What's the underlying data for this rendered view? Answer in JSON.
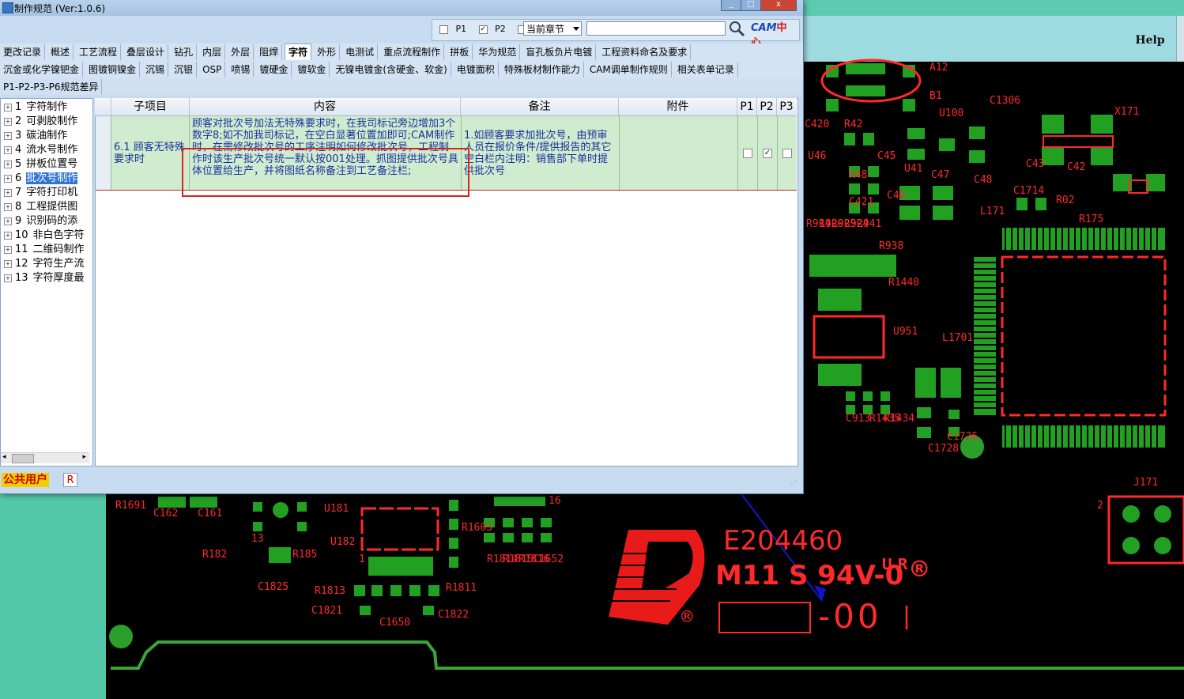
{
  "window": {
    "title": "制作规范 (Ver:1.0.6)",
    "min_label": "_",
    "max_label": "□",
    "close_label": "x"
  },
  "toolbar": {
    "p1_label": "P1",
    "p2_label": "P2",
    "p3_label": "P3",
    "p1_checked": false,
    "p2_checked": true,
    "p3_checked": false,
    "chapter_select": "当前章节",
    "search_value": "",
    "logo_text": "CAM",
    "logo_suffix": "中心"
  },
  "tabs_row1": [
    "更改记录",
    "概述",
    "工艺流程",
    "叠层设计",
    "钻孔",
    "内层",
    "外层",
    "阻焊",
    "字符",
    "外形",
    "电测试",
    "重点流程制作",
    "拼板",
    "华为规范",
    "盲孔板负片电镀",
    "工程资料命名及要求"
  ],
  "active_tab": "字符",
  "tabs_row2": [
    "沉金或化学镍钯金",
    "图镀铜镍金",
    "沉锡",
    "沉银",
    "OSP",
    "喷锡",
    "镀硬金",
    "镀软金",
    "无镍电镀金(含硬金、软金)",
    "电镀面积",
    "特殊板材制作能力",
    "CAM调单制作规则",
    "相关表单记录"
  ],
  "tabs_row3": [
    "P1-P2-P3-P6规范差异"
  ],
  "tree": [
    {
      "num": "1",
      "label": "字符制作"
    },
    {
      "num": "2",
      "label": "可剥胶制作"
    },
    {
      "num": "3",
      "label": "碳油制作"
    },
    {
      "num": "4",
      "label": "流水号制作"
    },
    {
      "num": "5",
      "label": "拼板位置号"
    },
    {
      "num": "6",
      "label": "批次号制作"
    },
    {
      "num": "7",
      "label": "字符打印机"
    },
    {
      "num": "8",
      "label": "工程提供图"
    },
    {
      "num": "9",
      "label": "识别码的添"
    },
    {
      "num": "10",
      "label": "非白色字符"
    },
    {
      "num": "11",
      "label": "二维码制作"
    },
    {
      "num": "12",
      "label": "字符生产流"
    },
    {
      "num": "13",
      "label": "字符厚度最"
    }
  ],
  "selected_tree_index": 5,
  "grid": {
    "headers": [
      "子项目",
      "内容",
      "备注",
      "附件",
      "P1",
      "P2",
      "P3"
    ],
    "rows": [
      {
        "subitem": "6.1 顾客无特殊要求时",
        "content": "顾客对批次号加法无特殊要求时，在我司标记旁边增加3个数字8;如不加我司标记，在空白显著位置加即可;CAM制作时，在需修改批次号的工序注明如何修改批次号，工程制作时该生产批次号统一默认按001处理。抓图提供批次号具体位置给生产，并将图纸名称备注到工艺备注栏;",
        "remark": "1.如顾客要求加批次号，由预审人员在报价条件/提供报告的其它空白栏内注明：销售部下单时提供批次号",
        "attachment": "",
        "p1": false,
        "p2": true,
        "p3": false
      }
    ]
  },
  "status": {
    "user": "公共用户",
    "badge": "R"
  },
  "background_app": {
    "help_label": "Help"
  },
  "pcb_silk": {
    "ul_number": "E204460",
    "material": "M11 S 94V-0",
    "batch": "-00",
    "refs": [
      "A12",
      "B1",
      "U100",
      "C1306",
      "X171",
      "C420",
      "R42",
      "U46",
      "C45",
      "U41",
      "C47",
      "C48",
      "C43",
      "C42",
      "R48",
      "C421",
      "C40",
      "C1714",
      "R02",
      "L171",
      "R175",
      "R914",
      "R920",
      "R925",
      "R924",
      "R941",
      "R938",
      "R1440",
      "U951",
      "L1701",
      "C913",
      "R1435",
      "R1434",
      "C1728",
      "C1726",
      "J171",
      "R1691",
      "C162",
      "C161",
      "U181",
      "U182",
      "R182",
      "R185",
      "C1825",
      "R1813",
      "R1811",
      "C1821",
      "C1650",
      "C1822",
      "R1814",
      "R1815",
      "R1816",
      "C1652",
      "R1603",
      "16",
      "13",
      "1",
      "2"
    ]
  },
  "colors": {
    "pcb_background": "#000000",
    "silk": "#ff2a2a",
    "copper": "#1f9e1f",
    "row_highlight": "#cfecce",
    "arrow": "#1515c8"
  }
}
